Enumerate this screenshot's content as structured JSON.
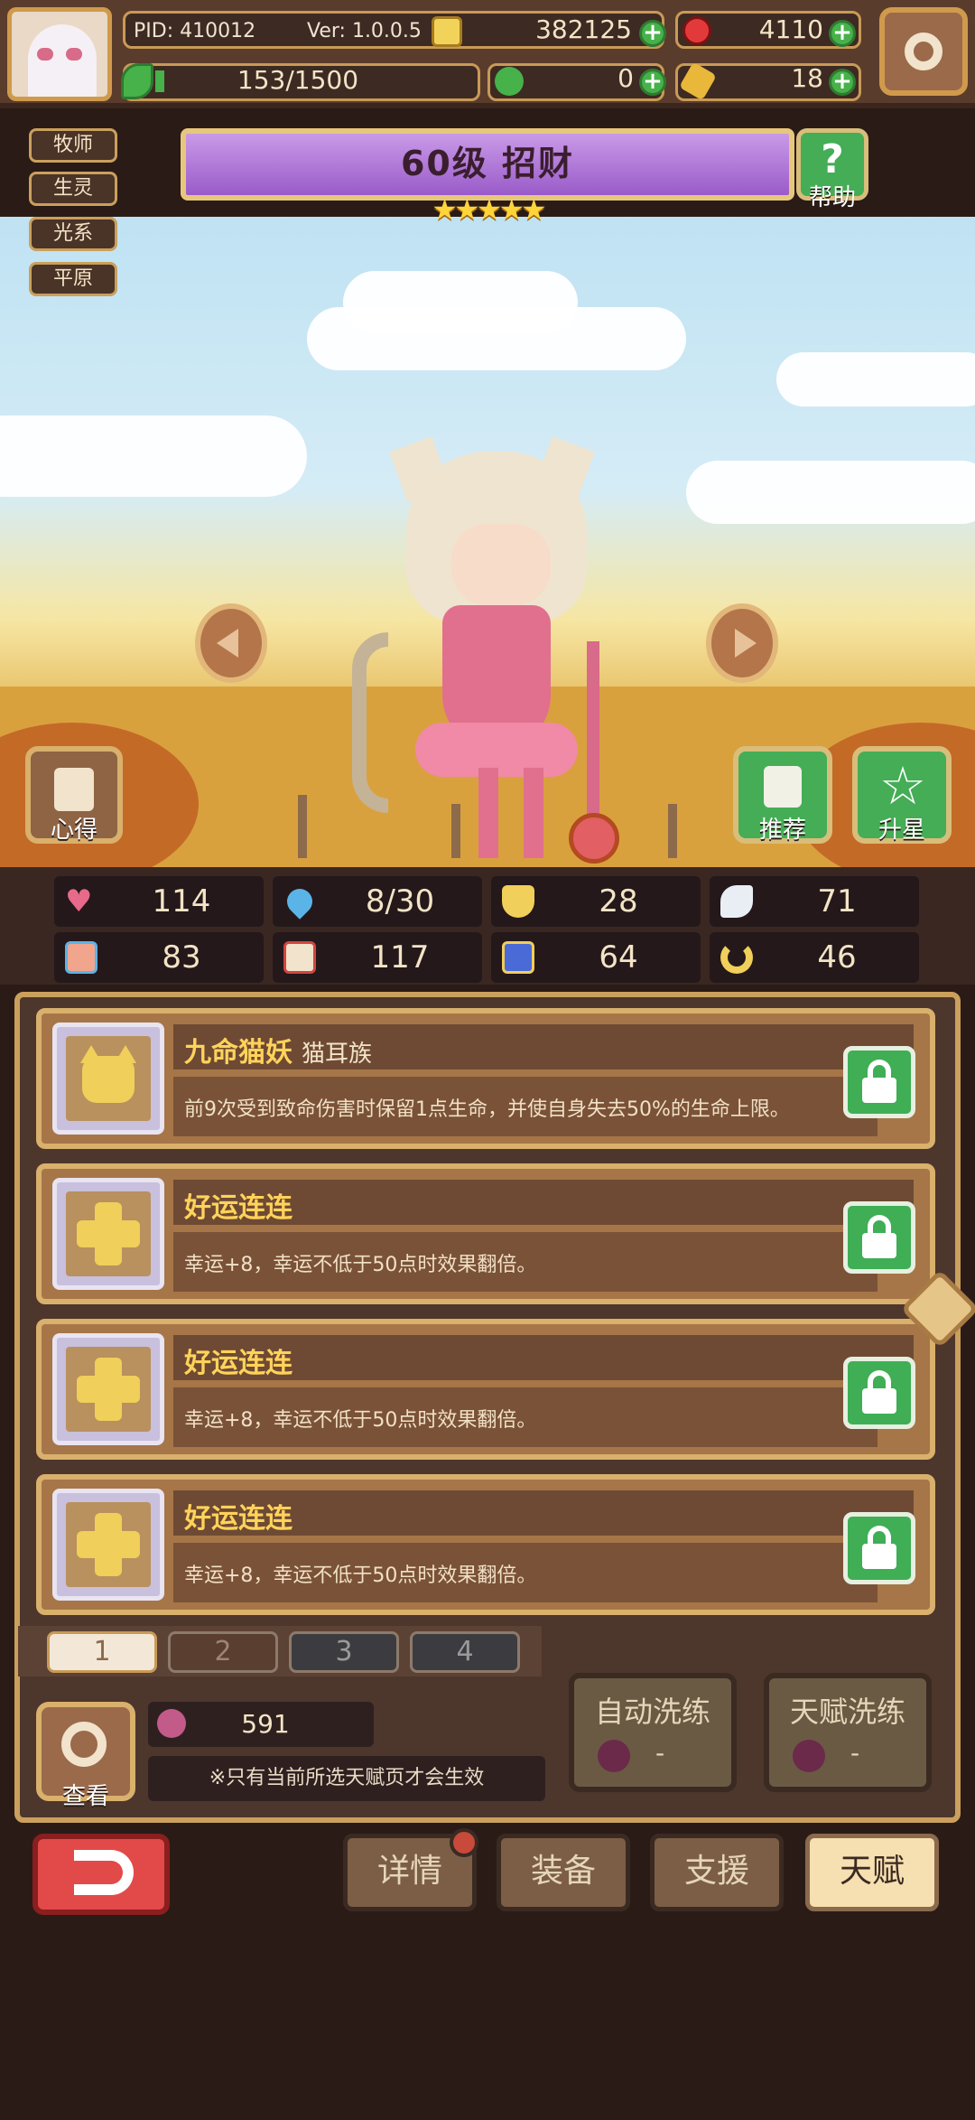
{
  "top": {
    "pid": "PID: 410012",
    "version": "Ver: 1.0.0.5",
    "gold": "382125",
    "gems": "4110",
    "clover": "0",
    "keys": "18",
    "exp": "153/1500"
  },
  "tags": [
    "牧师",
    "生灵",
    "光系",
    "平原"
  ],
  "hero": {
    "title": "60级  招财",
    "stars": 5,
    "help_label": "帮助",
    "insight_label": "心得",
    "recommend_label": "推荐",
    "upstar_label": "升星"
  },
  "stats": {
    "hp": "114",
    "mana": "8/30",
    "defense": "28",
    "speed": "71",
    "attack": "83",
    "magic": "117",
    "crit": "64",
    "luck": "46"
  },
  "talents": [
    {
      "name": "九命猫妖",
      "sub": "猫耳族",
      "desc": "前9次受到致命伤害时保留1点生命，并使自身失去50%的生命上限。"
    },
    {
      "name": "好运连连",
      "sub": "",
      "desc": "幸运+8，幸运不低于50点时效果翻倍。"
    },
    {
      "name": "好运连连",
      "sub": "",
      "desc": "幸运+8，幸运不低于50点时效果翻倍。"
    },
    {
      "name": "好运连连",
      "sub": "",
      "desc": "幸运+8，幸运不低于50点时效果翻倍。"
    }
  ],
  "pages": [
    "1",
    "2",
    "3",
    "4"
  ],
  "bottom_panel": {
    "view_label": "查看",
    "resource_count": "591",
    "notice": "※只有当前所选天赋页才会生效",
    "auto_refine_label": "自动洗练",
    "auto_refine_cost": "-",
    "talent_refine_label": "天赋洗练",
    "talent_refine_cost": "-"
  },
  "nav": {
    "details": "详情",
    "equip": "装备",
    "support": "支援",
    "talent": "天赋"
  },
  "colors": {
    "accent_gold": "#caa05c",
    "green_button": "#44ad56",
    "red_back": "#e24a4a",
    "purple_banner": "#9a5bc9"
  }
}
